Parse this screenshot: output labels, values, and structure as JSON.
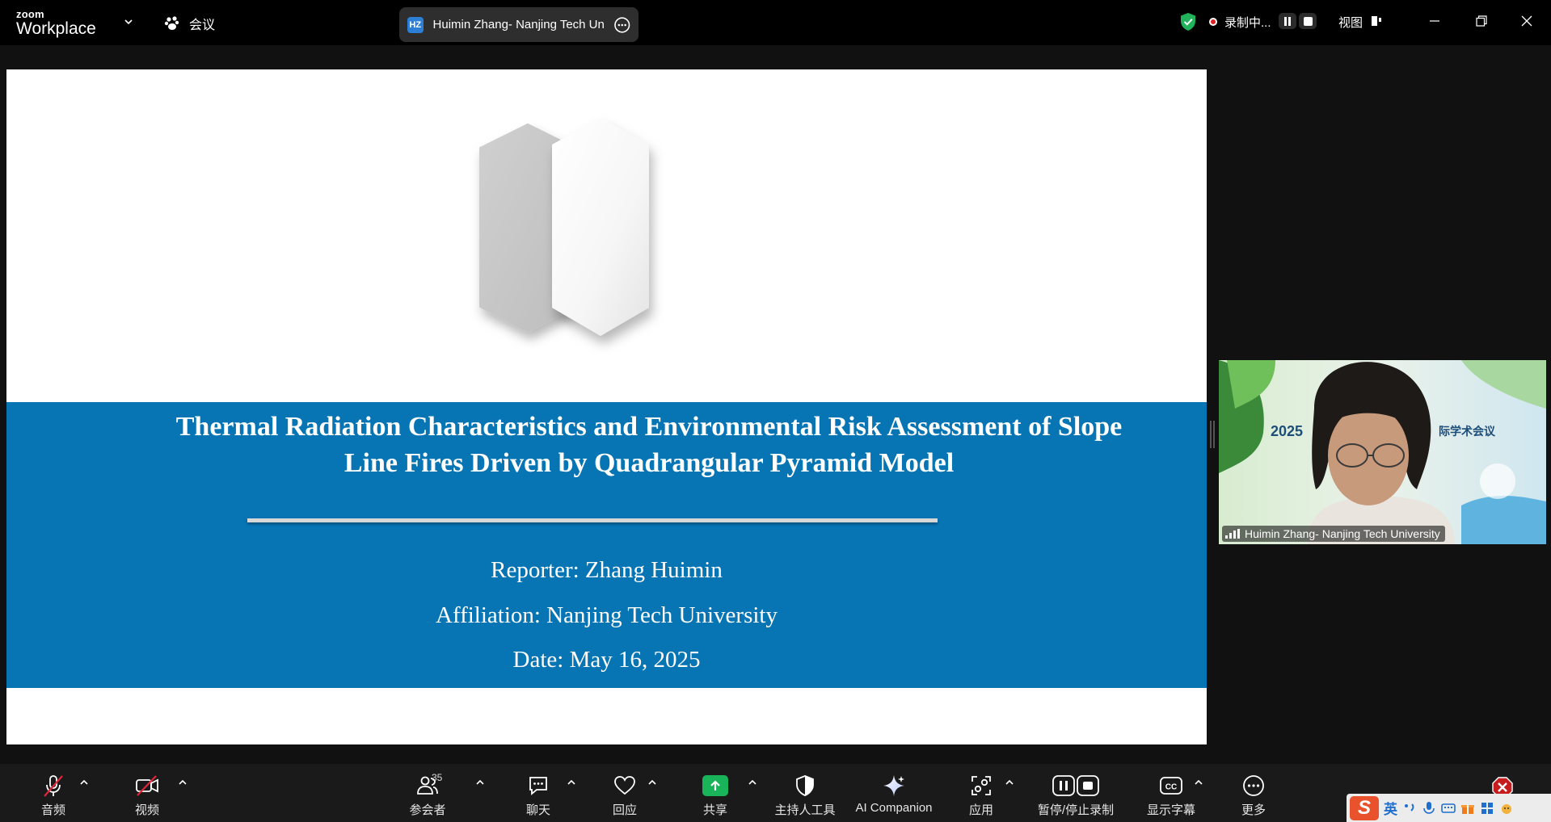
{
  "app": {
    "brand_small": "zoom",
    "brand_large": "Workplace",
    "meeting_label": "会议"
  },
  "speaker_pill": {
    "initials": "HZ",
    "name": "Huimin Zhang- Nanjing Tech Uni"
  },
  "status": {
    "recording_label": "录制中...",
    "view_label": "视图"
  },
  "slide": {
    "title": "Thermal Radiation Characteristics and Environmental Risk Assessment of Slope Line Fires Driven by Quadrangular Pyramid Model",
    "reporter": "Reporter: Zhang Huimin",
    "affiliation": "Affiliation: Nanjing Tech University",
    "date": "Date: May 16, 2025",
    "band_color": "#0774b4"
  },
  "video": {
    "participant_name": "Huimin Zhang- Nanjing Tech University",
    "banner_text": "2025",
    "banner_cn": "际学术会议"
  },
  "toolbar": {
    "audio": "音频",
    "video": "视频",
    "participants": "参会者",
    "participants_count": "35",
    "chat": "聊天",
    "react": "回应",
    "share": "共享",
    "host_tools": "主持人工具",
    "ai_companion": "AI Companion",
    "apps": "应用",
    "pause_stop_recording": "暂停/停止录制",
    "captions": "显示字幕",
    "more": "更多"
  },
  "ime": {
    "lang": "英"
  },
  "colors": {
    "accent_green": "#19b35a",
    "record_red": "#e02020",
    "shield_green": "#21b35b"
  }
}
